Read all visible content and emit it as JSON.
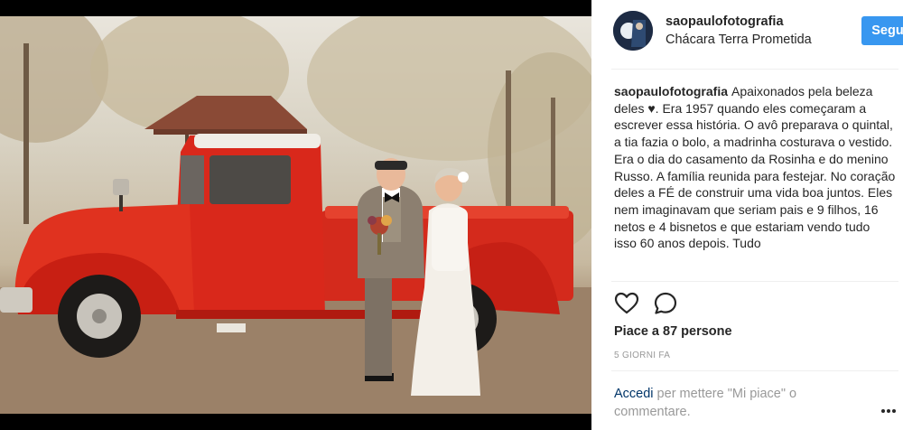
{
  "post": {
    "photo_alt": "Sposi anziani davanti a un pick-up rosso d'epoca",
    "header": {
      "username": "saopaulofotografia",
      "location": "Chácara Terra Prometida",
      "follow_label": "Segui"
    },
    "caption": {
      "username": "saopaulofotografia",
      "text": "Apaixonados pela beleza deles ♥. Era 1957 quando eles começaram a escrever essa história. O avô preparava o quintal, a tia fazia o bolo, a madrinha costurava o vestido. Era o dia do casamento da Rosinha e do menino Russo. A família reunida para festejar. No coração deles a FÉ de construir uma vida boa juntos. Eles nem imaginavam que seriam pais e 9 filhos, 16 netos e 4 bisnetos e que estariam vendo tudo isso 60 anos depois. Tudo"
    },
    "likes_text": "Piace a 87 persone",
    "time_ago": "5 GIORNI FA",
    "login_prompt": {
      "link": "Accedi",
      "text": " per mettere \"Mi piace\" o commentare."
    },
    "icons": {
      "like": "heart-icon",
      "comment": "comment-icon",
      "more": "more-options-icon"
    },
    "colors": {
      "follow_button": "#3897f0",
      "truck": "#d9281b",
      "link": "#003569"
    }
  }
}
